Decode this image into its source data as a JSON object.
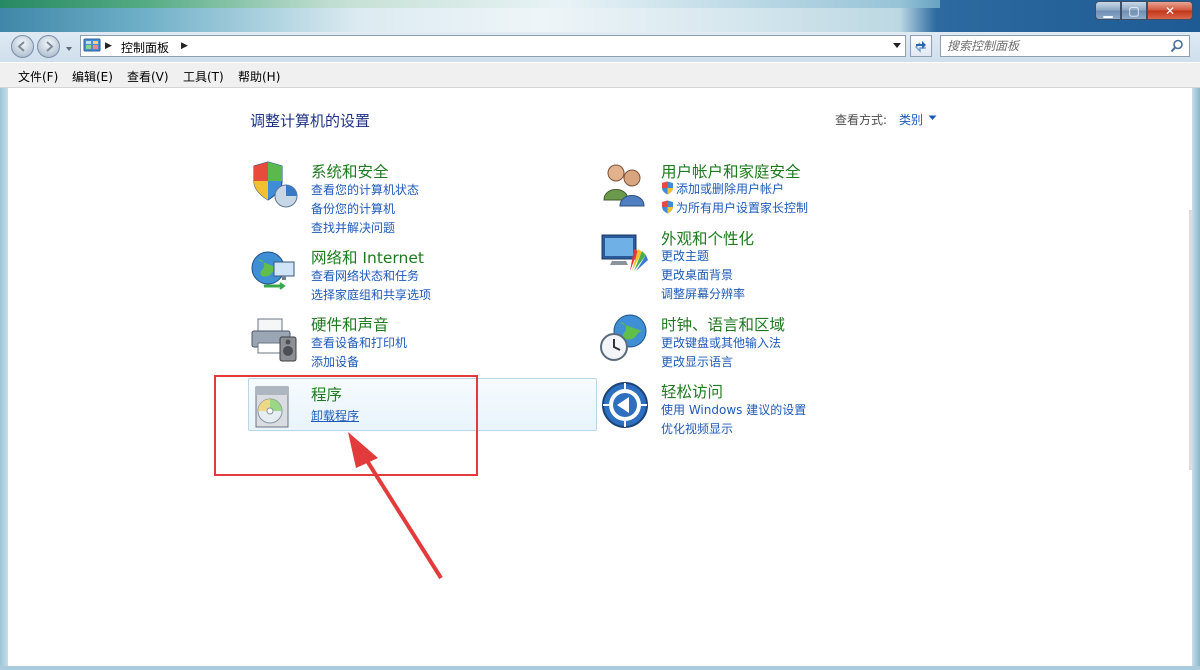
{
  "window": {
    "title": "控制面板",
    "caption_buttons": {
      "minimize": "▁",
      "maximize": "▢",
      "close": "✕"
    }
  },
  "address": {
    "breadcrumb": "控制面板",
    "search_placeholder": "搜索控制面板"
  },
  "menu": [
    "文件(F)",
    "编辑(E)",
    "查看(V)",
    "工具(T)",
    "帮助(H)"
  ],
  "page": {
    "title": "调整计算机的设置",
    "view_by_label": "查看方式:",
    "view_by_value": "类别"
  },
  "categories": [
    {
      "title": "系统和安全",
      "icon": "shield-system-icon",
      "links": [
        "查看您的计算机状态",
        "备份您的计算机",
        "查找并解决问题"
      ]
    },
    {
      "title": "网络和 Internet",
      "icon": "network-globe-icon",
      "links": [
        "查看网络状态和任务",
        "选择家庭组和共享选项"
      ]
    },
    {
      "title": "硬件和声音",
      "icon": "printer-speaker-icon",
      "links": [
        "查看设备和打印机",
        "添加设备"
      ]
    },
    {
      "title": "程序",
      "icon": "programs-disc-icon",
      "links": [
        "卸载程序"
      ]
    },
    {
      "title": "用户帐户和家庭安全",
      "icon": "users-icon",
      "links": [
        "添加或删除用户帐户",
        "为所有用户设置家长控制"
      ]
    },
    {
      "title": "外观和个性化",
      "icon": "monitor-palette-icon",
      "links": [
        "更改主题",
        "更改桌面背景",
        "调整屏幕分辨率"
      ]
    },
    {
      "title": "时钟、语言和区域",
      "icon": "clock-globe-icon",
      "links": [
        "更改键盘或其他输入法",
        "更改显示语言"
      ]
    },
    {
      "title": "轻松访问",
      "icon": "ease-of-access-icon",
      "links": [
        "使用 Windows 建议的设置",
        "优化视频显示"
      ]
    }
  ],
  "colors": {
    "category_title": "#1e7a1e",
    "link": "#1e5bb8",
    "page_title": "#1e3287",
    "highlight_border": "#e23b3b"
  }
}
